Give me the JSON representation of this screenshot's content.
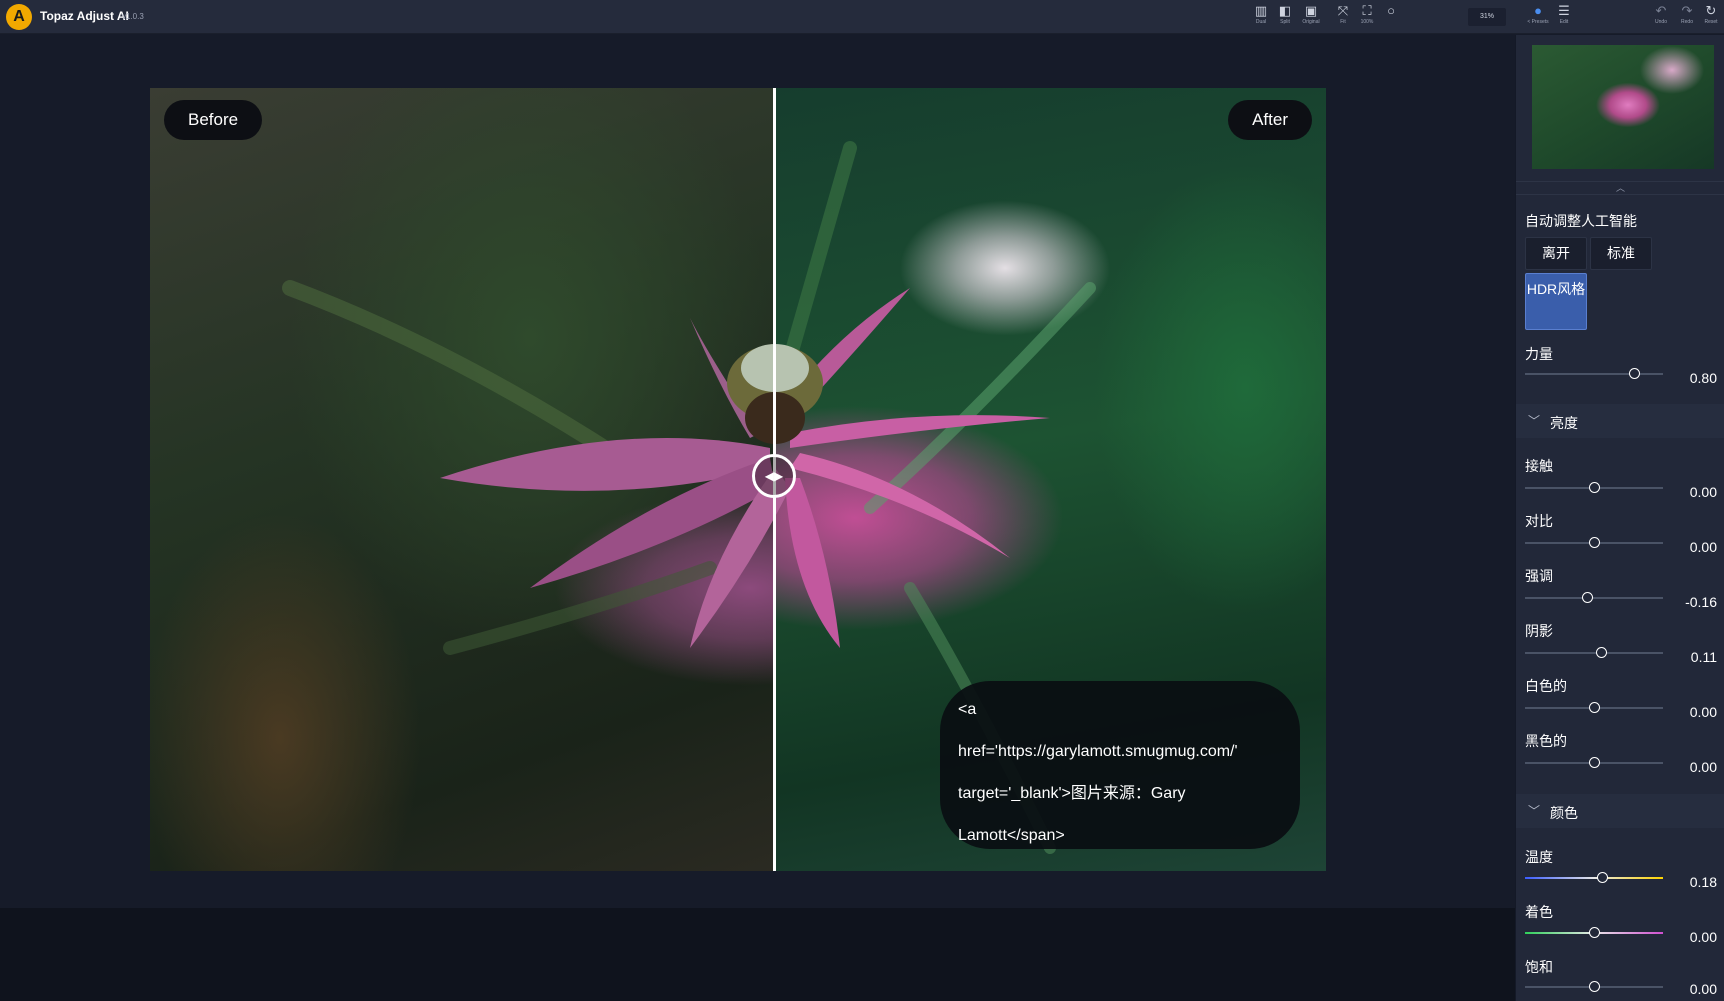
{
  "topbar": {
    "logo_letter": "A",
    "app_title": "Topaz Adjust AI",
    "version": "v1.0.3",
    "tools": [
      {
        "label": "Dual",
        "icon": "dual-view-icon"
      },
      {
        "label": "Split",
        "icon": "split-view-icon"
      },
      {
        "label": "Original",
        "icon": "original-image-icon"
      },
      {
        "label": "Fit",
        "icon": "fit-icon"
      },
      {
        "label": "100%",
        "icon": "actual-size-icon"
      }
    ],
    "zoom_value": "31%",
    "presets_label": "< Presets",
    "edit_label": "Edit",
    "undo_label": "Undo",
    "redo_label": "Redo",
    "reset_label": "Reset"
  },
  "preview": {
    "before_label": "Before",
    "after_label": "After",
    "caption": "<a\nhref='https://garylamott.smugmug.com/'\ntarget='_blank'>图片来源：Gary\nLamott</span>"
  },
  "panel": {
    "ai_title": "自动调整人工智能",
    "modes": {
      "off": "离开",
      "standard": "标准",
      "hdr": "HDR风格",
      "active": "hdr"
    },
    "strength": {
      "label": "力量",
      "value": "0.80"
    },
    "brightness": {
      "title": "亮度",
      "sliders": [
        {
          "label": "接触",
          "value": "0.00"
        },
        {
          "label": "对比",
          "value": "0.00"
        },
        {
          "label": "强调",
          "value": "-0.16"
        },
        {
          "label": "阴影",
          "value": "0.11"
        },
        {
          "label": "白色的",
          "value": "0.00"
        },
        {
          "label": "黑色的",
          "value": "0.00"
        }
      ]
    },
    "color": {
      "title": "颜色",
      "sliders": [
        {
          "label": "温度",
          "value": "0.18"
        },
        {
          "label": "着色",
          "value": "0.00"
        },
        {
          "label": "饱和",
          "value": "0.00"
        }
      ]
    }
  }
}
